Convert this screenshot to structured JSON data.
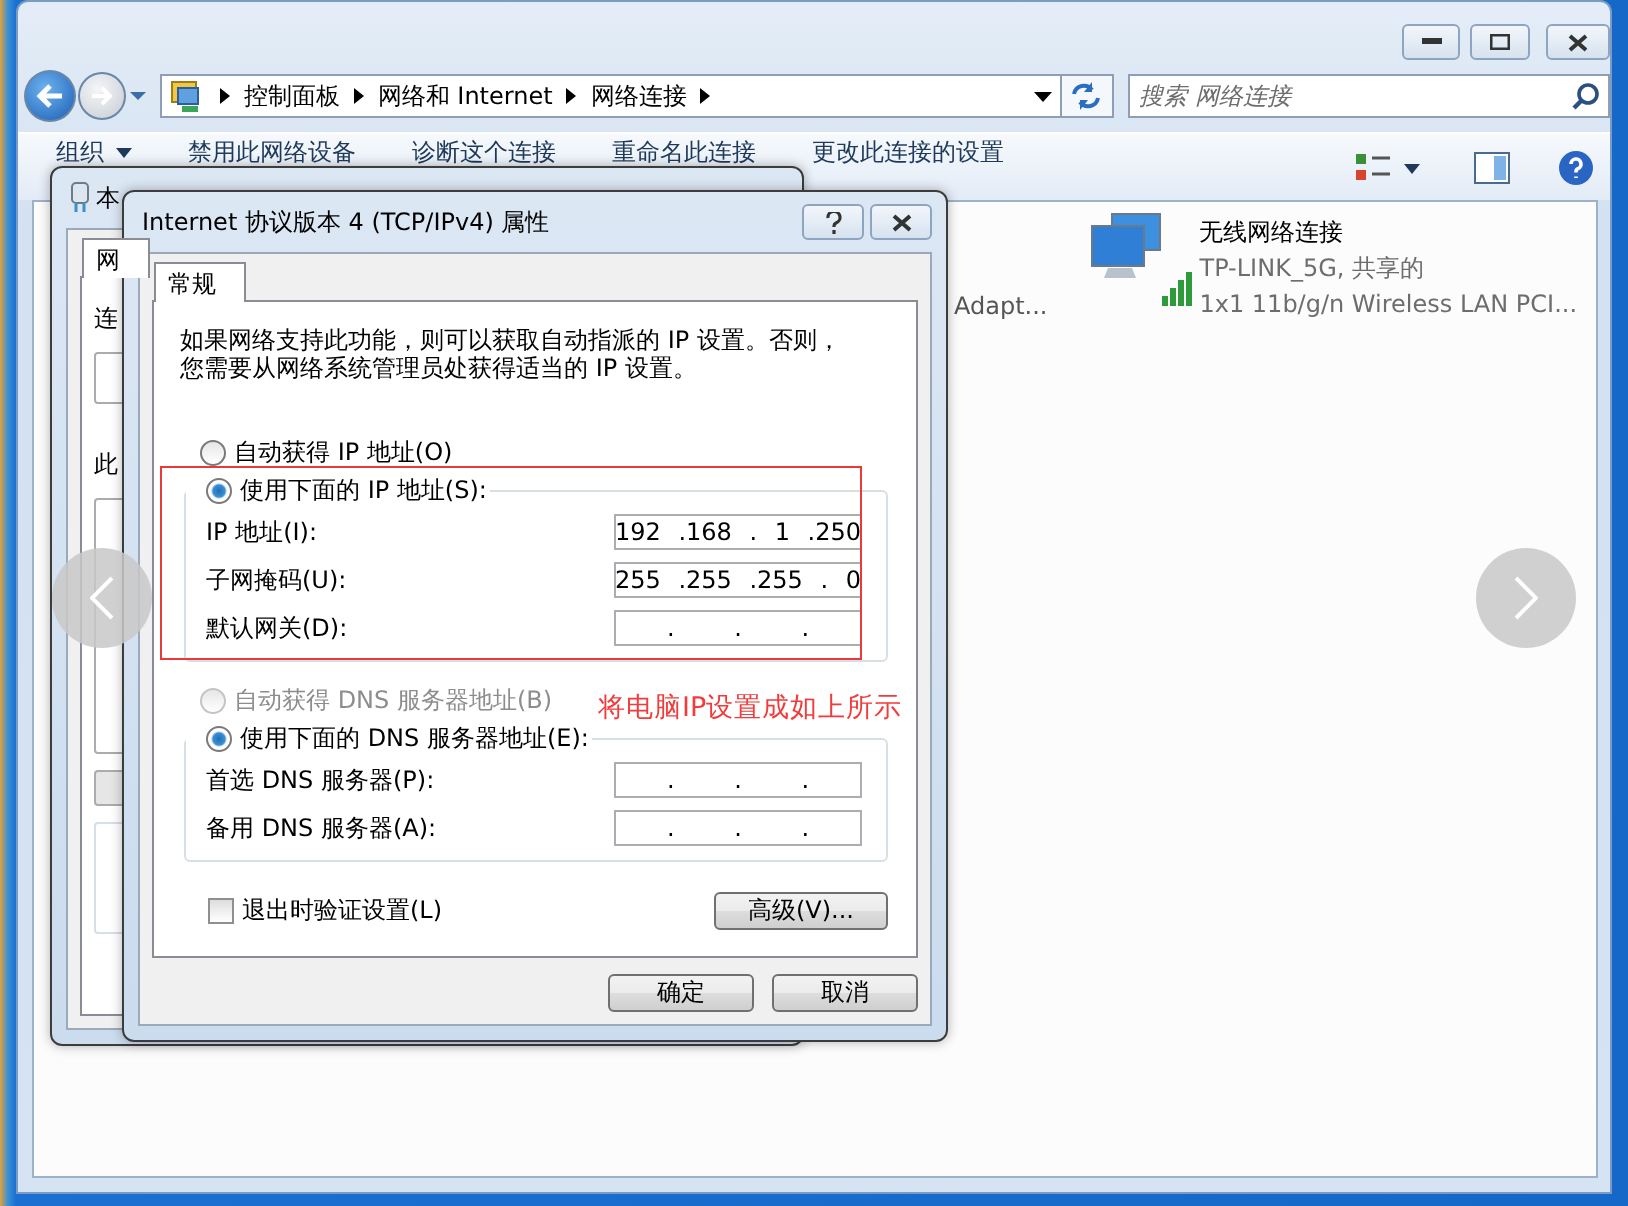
{
  "explorer": {
    "breadcrumbs": [
      "控制面板",
      "网络和 Internet",
      "网络连接"
    ],
    "search": {
      "placeholder": "搜索 网络连接"
    },
    "toolbar": [
      {
        "label": "组织",
        "menu": true
      },
      {
        "label": "禁用此网络设备",
        "menu": false
      },
      {
        "label": "诊断这个连接",
        "menu": false
      },
      {
        "label": "重命名此连接",
        "menu": false
      },
      {
        "label": "更改此连接的设置",
        "menu": false
      }
    ],
    "partial_item": {
      "device": "Adapt..."
    },
    "connections": [
      {
        "name": "无线网络连接",
        "status": "TP-LINK_5G, 共享的",
        "device": "1x1 11b/g/n Wireless LAN PCI..."
      }
    ]
  },
  "back_dialog": {
    "title": "本",
    "tab": "网",
    "labels": [
      "连",
      "此"
    ]
  },
  "dialog": {
    "title": "Internet 协议版本 4 (TCP/IPv4) 属性",
    "tabs": [
      {
        "label": "常规",
        "selected": true
      }
    ],
    "description": [
      "如果网络支持此功能，则可以获取自动指派的 IP 设置。否则，",
      "您需要从网络系统管理员处获得适当的 IP 设置。"
    ],
    "ip_mode": [
      {
        "label": "自动获得 IP 地址(O)",
        "selected": false,
        "disabled": false
      },
      {
        "label": "使用下面的 IP 地址(S):",
        "selected": true,
        "disabled": false
      }
    ],
    "ip_fields": [
      {
        "label": "IP 地址(I):",
        "value": "192 .168 . 1 .250"
      },
      {
        "label": "子网掩码(U):",
        "value": "255 .255 .255 . 0"
      },
      {
        "label": "默认网关(D):",
        "value": ". . ."
      }
    ],
    "dns_mode": [
      {
        "label": "自动获得 DNS 服务器地址(B)",
        "selected": false,
        "disabled": true
      },
      {
        "label": "使用下面的 DNS 服务器地址(E):",
        "selected": true,
        "disabled": false
      }
    ],
    "dns_fields": [
      {
        "label": "首选 DNS 服务器(P):",
        "value": ". . ."
      },
      {
        "label": "备用 DNS 服务器(A):",
        "value": ". . ."
      }
    ],
    "validate": {
      "label": "退出时验证设置(L)",
      "checked": false
    },
    "advanced_button": "高级(V)...",
    "buttons": [
      "确定",
      "取消"
    ]
  },
  "annotation": {
    "text": "将电脑IP设置成如上所示"
  }
}
